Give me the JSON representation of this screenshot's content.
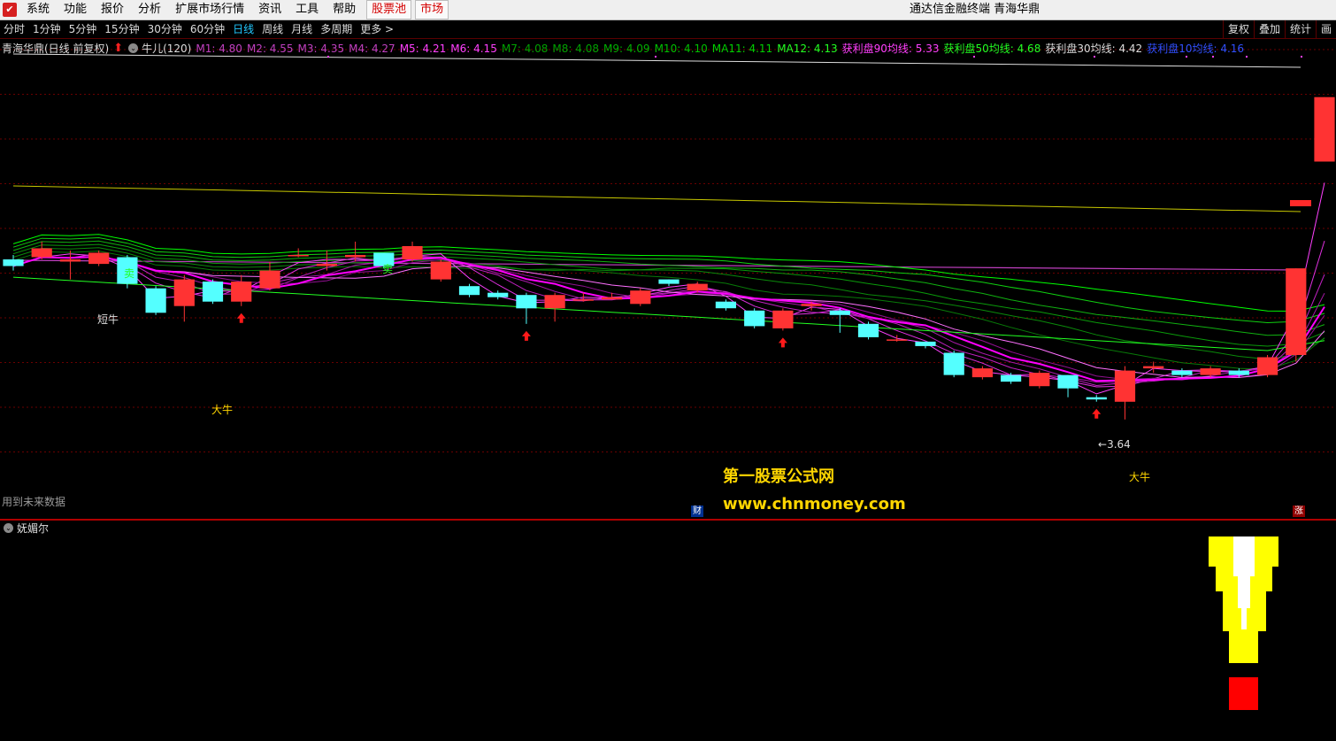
{
  "menubar": {
    "items": [
      "系统",
      "功能",
      "报价",
      "分析",
      "扩展市场行情",
      "资讯",
      "工具",
      "帮助"
    ],
    "highlighted": [
      "股票池",
      "市场"
    ],
    "app_title": "通达信金融终端 青海华鼎"
  },
  "periodbar": {
    "periods": [
      "分时",
      "1分钟",
      "5分钟",
      "15分钟",
      "30分钟",
      "60分钟",
      "日线",
      "周线",
      "月线",
      "多周期",
      "更多 >"
    ],
    "active": "日线",
    "tools": [
      "复权",
      "叠加",
      "统计",
      "画"
    ]
  },
  "legend": {
    "stock": "青海华鼎(日线 前复权)",
    "indicator": "牛儿(120)",
    "items": [
      {
        "label": "M1: 4.80",
        "color": "#c040c0"
      },
      {
        "label": "M2: 4.55",
        "color": "#c040c0"
      },
      {
        "label": "M3: 4.35",
        "color": "#c040c0"
      },
      {
        "label": "M4: 4.27",
        "color": "#c040c0"
      },
      {
        "label": "M5: 4.21",
        "color": "#ff40ff"
      },
      {
        "label": "M6: 4.15",
        "color": "#ff40ff"
      },
      {
        "label": "M7: 4.08",
        "color": "#00a000"
      },
      {
        "label": "M8: 4.08",
        "color": "#00a000"
      },
      {
        "label": "M9: 4.09",
        "color": "#00b000"
      },
      {
        "label": "M10: 4.10",
        "color": "#00c000"
      },
      {
        "label": "MA11: 4.11",
        "color": "#00d000"
      },
      {
        "label": "MA12: 4.13",
        "color": "#22ff22"
      },
      {
        "label": "获利盘90均线: 5.33",
        "color": "#ff40ff"
      },
      {
        "label": "获利盘50均线: 4.68",
        "color": "#22ff22"
      },
      {
        "label": "获利盘30均线: 4.42",
        "color": "#dddddd"
      },
      {
        "label": "获利盘10均线: 4.16",
        "color": "#3050ff"
      }
    ]
  },
  "annotations": {
    "sell": "卖",
    "short_buy": "短牛",
    "big_bull": "大牛",
    "low_price": "3.64",
    "future_note": "用到未来数据",
    "badge_cai": "财",
    "badge_zhang": "涨"
  },
  "watermark": {
    "cn": "第一股票公式网",
    "url": "www.chnmoney.com"
  },
  "subchart": {
    "title": "妩媚尔"
  },
  "colors": {
    "up": "#ff3333",
    "down": "#54ffff",
    "ma_pink": "#ff40ff",
    "ma_green": "#22ff22",
    "yellow": "#ffff00"
  },
  "chart_data": {
    "type": "candlestick",
    "title": "青海华鼎(日线 前复权)",
    "last_values": {
      "M1": 4.8,
      "M2": 4.55,
      "M3": 4.35,
      "M4": 4.27,
      "M5": 4.21,
      "M6": 4.15,
      "M7": 4.08,
      "M8": 4.08,
      "M9": 4.09,
      "M10": 4.1,
      "MA11": 4.11,
      "MA12": 4.13,
      "获利盘90均线": 5.33,
      "获利盘50均线": 4.68,
      "获利盘30均线": 4.42,
      "获利盘10均线": 4.16
    },
    "lowest_marked": 3.64,
    "candles": [
      {
        "o": 4.36,
        "c": 4.33,
        "h": 4.38,
        "l": 4.31
      },
      {
        "o": 4.37,
        "c": 4.41,
        "h": 4.44,
        "l": 4.36
      },
      {
        "o": 4.35,
        "c": 4.36,
        "h": 4.4,
        "l": 4.27
      },
      {
        "o": 4.34,
        "c": 4.39,
        "h": 4.4,
        "l": 4.33
      },
      {
        "o": 4.37,
        "c": 4.25,
        "h": 4.38,
        "l": 4.23
      },
      {
        "o": 4.23,
        "c": 4.12,
        "h": 4.24,
        "l": 4.11
      },
      {
        "o": 4.15,
        "c": 4.27,
        "h": 4.29,
        "l": 4.08
      },
      {
        "o": 4.26,
        "c": 4.17,
        "h": 4.27,
        "l": 4.16
      },
      {
        "o": 4.17,
        "c": 4.26,
        "h": 4.29,
        "l": 4.15
      },
      {
        "o": 4.23,
        "c": 4.31,
        "h": 4.35,
        "l": 4.22
      },
      {
        "o": 4.38,
        "c": 4.38,
        "h": 4.41,
        "l": 4.37
      },
      {
        "o": 4.33,
        "c": 4.34,
        "h": 4.4,
        "l": 4.31
      },
      {
        "o": 4.37,
        "c": 4.38,
        "h": 4.44,
        "l": 4.35
      },
      {
        "o": 4.39,
        "c": 4.33,
        "h": 4.39,
        "l": 4.32
      },
      {
        "o": 4.36,
        "c": 4.42,
        "h": 4.44,
        "l": 4.35
      },
      {
        "o": 4.27,
        "c": 4.35,
        "h": 4.36,
        "l": 4.26
      },
      {
        "o": 4.24,
        "c": 4.2,
        "h": 4.25,
        "l": 4.19
      },
      {
        "o": 4.21,
        "c": 4.19,
        "h": 4.22,
        "l": 4.18
      },
      {
        "o": 4.2,
        "c": 4.14,
        "h": 4.21,
        "l": 4.07
      },
      {
        "o": 4.14,
        "c": 4.2,
        "h": 4.21,
        "l": 4.08
      },
      {
        "o": 4.18,
        "c": 4.18,
        "h": 4.21,
        "l": 4.17
      },
      {
        "o": 4.18,
        "c": 4.19,
        "h": 4.21,
        "l": 4.18
      },
      {
        "o": 4.16,
        "c": 4.22,
        "h": 4.23,
        "l": 4.15
      },
      {
        "o": 4.27,
        "c": 4.25,
        "h": 4.27,
        "l": 4.24
      },
      {
        "o": 4.22,
        "c": 4.25,
        "h": 4.26,
        "l": 4.21
      },
      {
        "o": 4.17,
        "c": 4.14,
        "h": 4.18,
        "l": 4.13
      },
      {
        "o": 4.13,
        "c": 4.06,
        "h": 4.14,
        "l": 4.05
      },
      {
        "o": 4.05,
        "c": 4.13,
        "h": 4.14,
        "l": 4.04
      },
      {
        "o": 4.15,
        "c": 4.16,
        "h": 4.17,
        "l": 4.13
      },
      {
        "o": 4.13,
        "c": 4.11,
        "h": 4.14,
        "l": 4.03
      },
      {
        "o": 4.07,
        "c": 4.01,
        "h": 4.08,
        "l": 4.0
      },
      {
        "o": 4.0,
        "c": 4.0,
        "h": 4.02,
        "l": 3.99
      },
      {
        "o": 3.99,
        "c": 3.97,
        "h": 3.99,
        "l": 3.96
      },
      {
        "o": 3.94,
        "c": 3.84,
        "h": 3.95,
        "l": 3.83
      },
      {
        "o": 3.83,
        "c": 3.87,
        "h": 3.88,
        "l": 3.82
      },
      {
        "o": 3.84,
        "c": 3.81,
        "h": 3.85,
        "l": 3.8
      },
      {
        "o": 3.79,
        "c": 3.85,
        "h": 3.86,
        "l": 3.78
      },
      {
        "o": 3.84,
        "c": 3.78,
        "h": 3.84,
        "l": 3.74
      },
      {
        "o": 3.74,
        "c": 3.73,
        "h": 3.75,
        "l": 3.72
      },
      {
        "o": 3.72,
        "c": 3.86,
        "h": 3.88,
        "l": 3.64
      },
      {
        "o": 3.87,
        "c": 3.88,
        "h": 3.9,
        "l": 3.85
      },
      {
        "o": 3.86,
        "c": 3.84,
        "h": 3.87,
        "l": 3.83
      },
      {
        "o": 3.84,
        "c": 3.87,
        "h": 3.88,
        "l": 3.83
      },
      {
        "o": 3.86,
        "c": 3.84,
        "h": 3.87,
        "l": 3.83
      },
      {
        "o": 3.84,
        "c": 3.92,
        "h": 3.93,
        "l": 3.83
      },
      {
        "o": 3.93,
        "c": 4.32,
        "h": 4.32,
        "l": 3.9
      },
      {
        "o": 4.8,
        "c": 5.09,
        "h": 5.09,
        "l": 4.8
      }
    ]
  }
}
